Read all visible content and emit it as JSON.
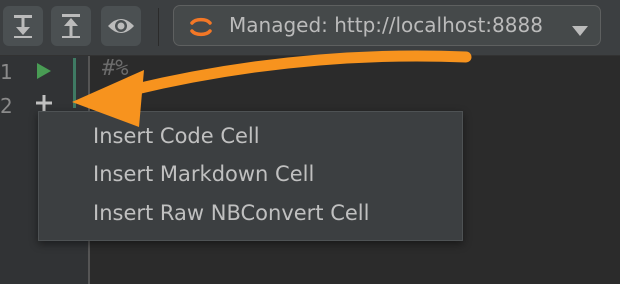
{
  "toolbar": {
    "buttons": [
      {
        "icon": "run-all-icon"
      },
      {
        "icon": "run-all-above-icon"
      },
      {
        "icon": "preview-eye-icon"
      }
    ],
    "server": {
      "icon": "jupyter-icon",
      "label": "Managed: http://localhost:8888",
      "dropdown_icon": "chevron-down-icon"
    }
  },
  "editor": {
    "line_numbers": [
      "1",
      "2"
    ],
    "line1_text": "#%",
    "gutter_icons": [
      "run-cell-icon",
      "add-cell-icon"
    ]
  },
  "context_menu": {
    "items": [
      {
        "label": "Insert Code Cell"
      },
      {
        "label": "Insert Markdown Cell"
      },
      {
        "label": "Insert Raw NBConvert Cell"
      }
    ]
  },
  "annotation": {
    "arrow_color": "#f7931e"
  },
  "colors": {
    "background": "#2b2b2b",
    "toolbar": "#3c3f41",
    "menu": "#3c3f41",
    "run_green": "#499c54",
    "accent_orange": "#f7931e"
  }
}
